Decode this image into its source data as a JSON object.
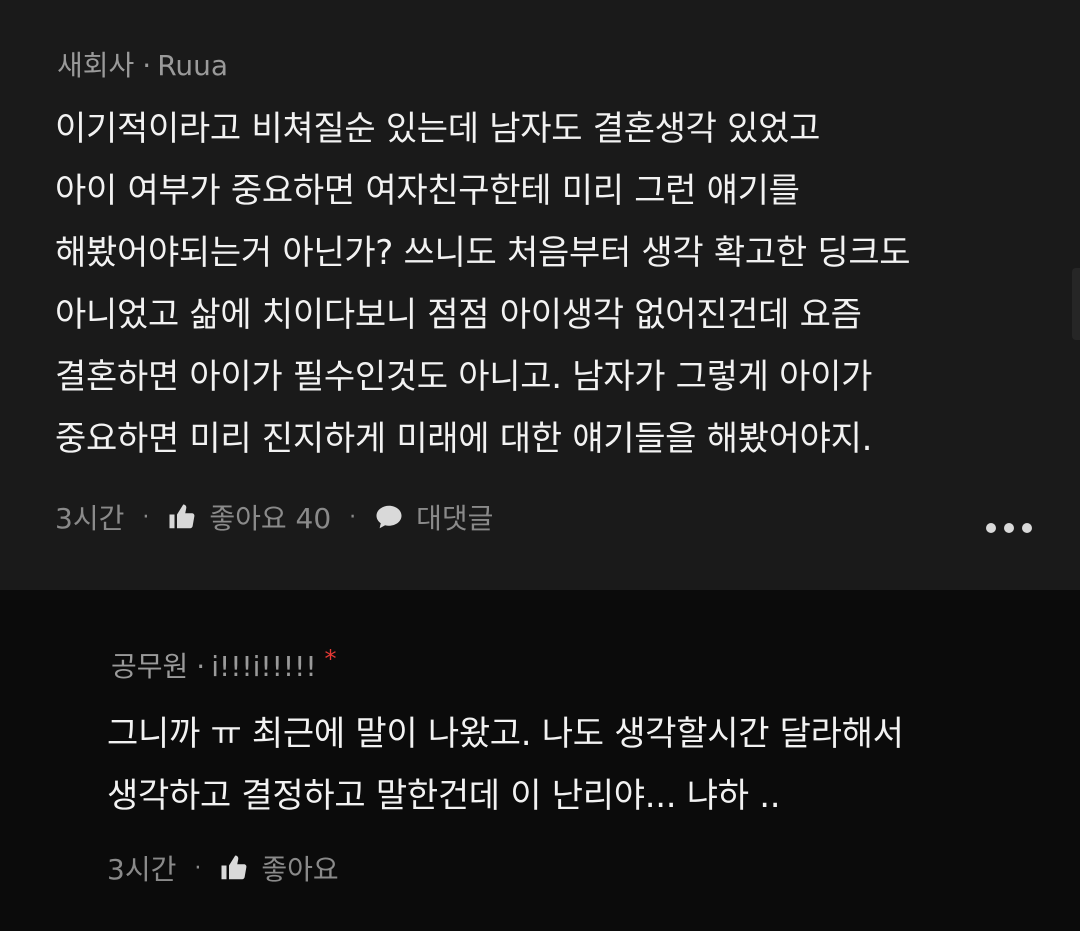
{
  "comment": {
    "company": "새회사",
    "separator": "·",
    "username": "Ruua",
    "body": "이기적이라고 비쳐질순 있는데 남자도 결혼생각 있었고\n아이 여부가 중요하면 여자친구한테 미리 그런 얘기를\n해봤어야되는거 아닌가? 쓰니도 처음부터 생각 확고한 딩크도\n아니었고 삶에 치이다보니 점점 아이생각 없어진건데 요즘\n결혼하면 아이가 필수인것도 아니고. 남자가 그렇게 아이가\n중요하면 미리 진지하게 미래에 대한 얘기들을 해봤어야지.",
    "time": "3시간",
    "like_label": "좋아요 40",
    "reply_label": "대댓글",
    "icons": {
      "like": "thumbs-up-icon",
      "reply": "speech-bubble-icon",
      "more": "more-dots-icon"
    }
  },
  "reply": {
    "company": "공무원",
    "separator": "·",
    "username": "i!!!i!!!!!",
    "author_marker": "*",
    "body": "그니까 ㅠ 최근에 말이 나왔고. 나도 생각할시간 달라해서\n생각하고 결정하고 말한건데 이 난리야... 냐하 ..",
    "time": "3시간",
    "like_label": "좋아요"
  },
  "colors": {
    "background_main": "#1a1a1a",
    "background_reply": "#0b0b0b",
    "text_primary": "#f2f2f2",
    "text_secondary": "#8a8a8a",
    "author_marker": "#e53935"
  }
}
